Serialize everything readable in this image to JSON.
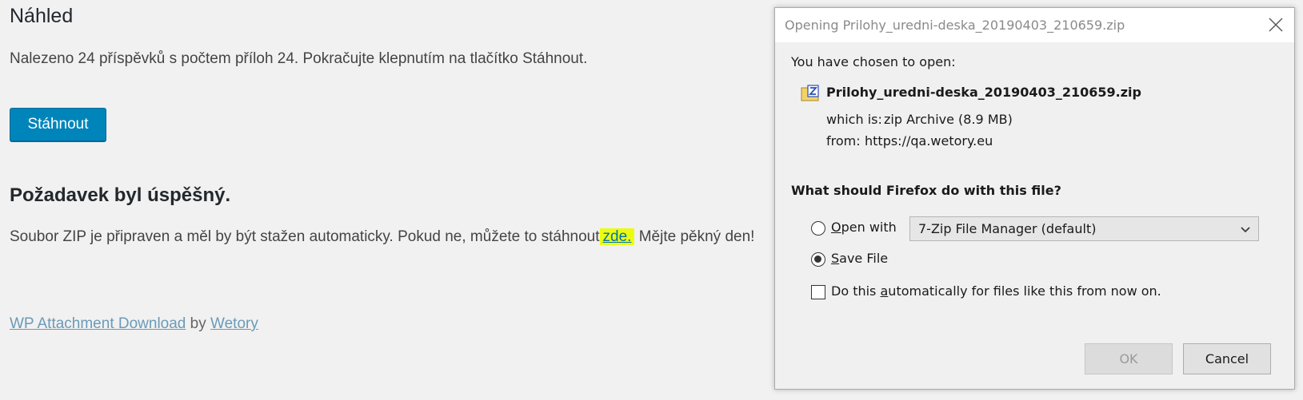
{
  "page": {
    "preview_heading": "Náhled",
    "found_text": "Nalezeno 24 příspěvků s počtem příloh 24. Pokračujte klepnutím na tlačítko Stáhnout.",
    "download_button": "Stáhnout",
    "success_heading": "Požadavek byl úspěšný.",
    "zip_text_before": "Soubor ZIP je připraven a měl by být stažen automaticky. Pokud ne, můžete to stáhnout",
    "zip_link": "zde.",
    "zip_text_after": " Mějte pěkný den!",
    "footer": {
      "plugin_link": "WP Attachment Download",
      "by": "by",
      "author_link": "Wetory"
    }
  },
  "dialog": {
    "title": "Opening Prilohy_uredni-deska_20190403_210659.zip",
    "chosen_label": "You have chosen to open:",
    "file_name": "Prilohy_uredni-deska_20190403_210659.zip",
    "which_is_label": "which is:",
    "which_is_value": "zip Archive (8.9 MB)",
    "from_label": "from:",
    "from_value": "https://qa.wetory.eu",
    "question": "What should Firefox do with this file?",
    "open_with": {
      "accel": "O",
      "rest": "pen with"
    },
    "open_with_app": "7-Zip File Manager (default)",
    "save_file": {
      "accel": "S",
      "rest": "ave File"
    },
    "auto": {
      "before": "Do this ",
      "accel": "a",
      "after": "utomatically for files like this from now on."
    },
    "ok_button": "OK",
    "cancel_button": "Cancel",
    "selected_option": "save-file",
    "auto_checked": false
  },
  "colors": {
    "button_blue": "#0085ba",
    "link_highlight": "#ecfc10",
    "page_bg": "#f1f1f1"
  },
  "icons": {
    "zip_file": "zip-file-icon",
    "close": "close-icon",
    "dropdown": "chevron-down-icon"
  }
}
